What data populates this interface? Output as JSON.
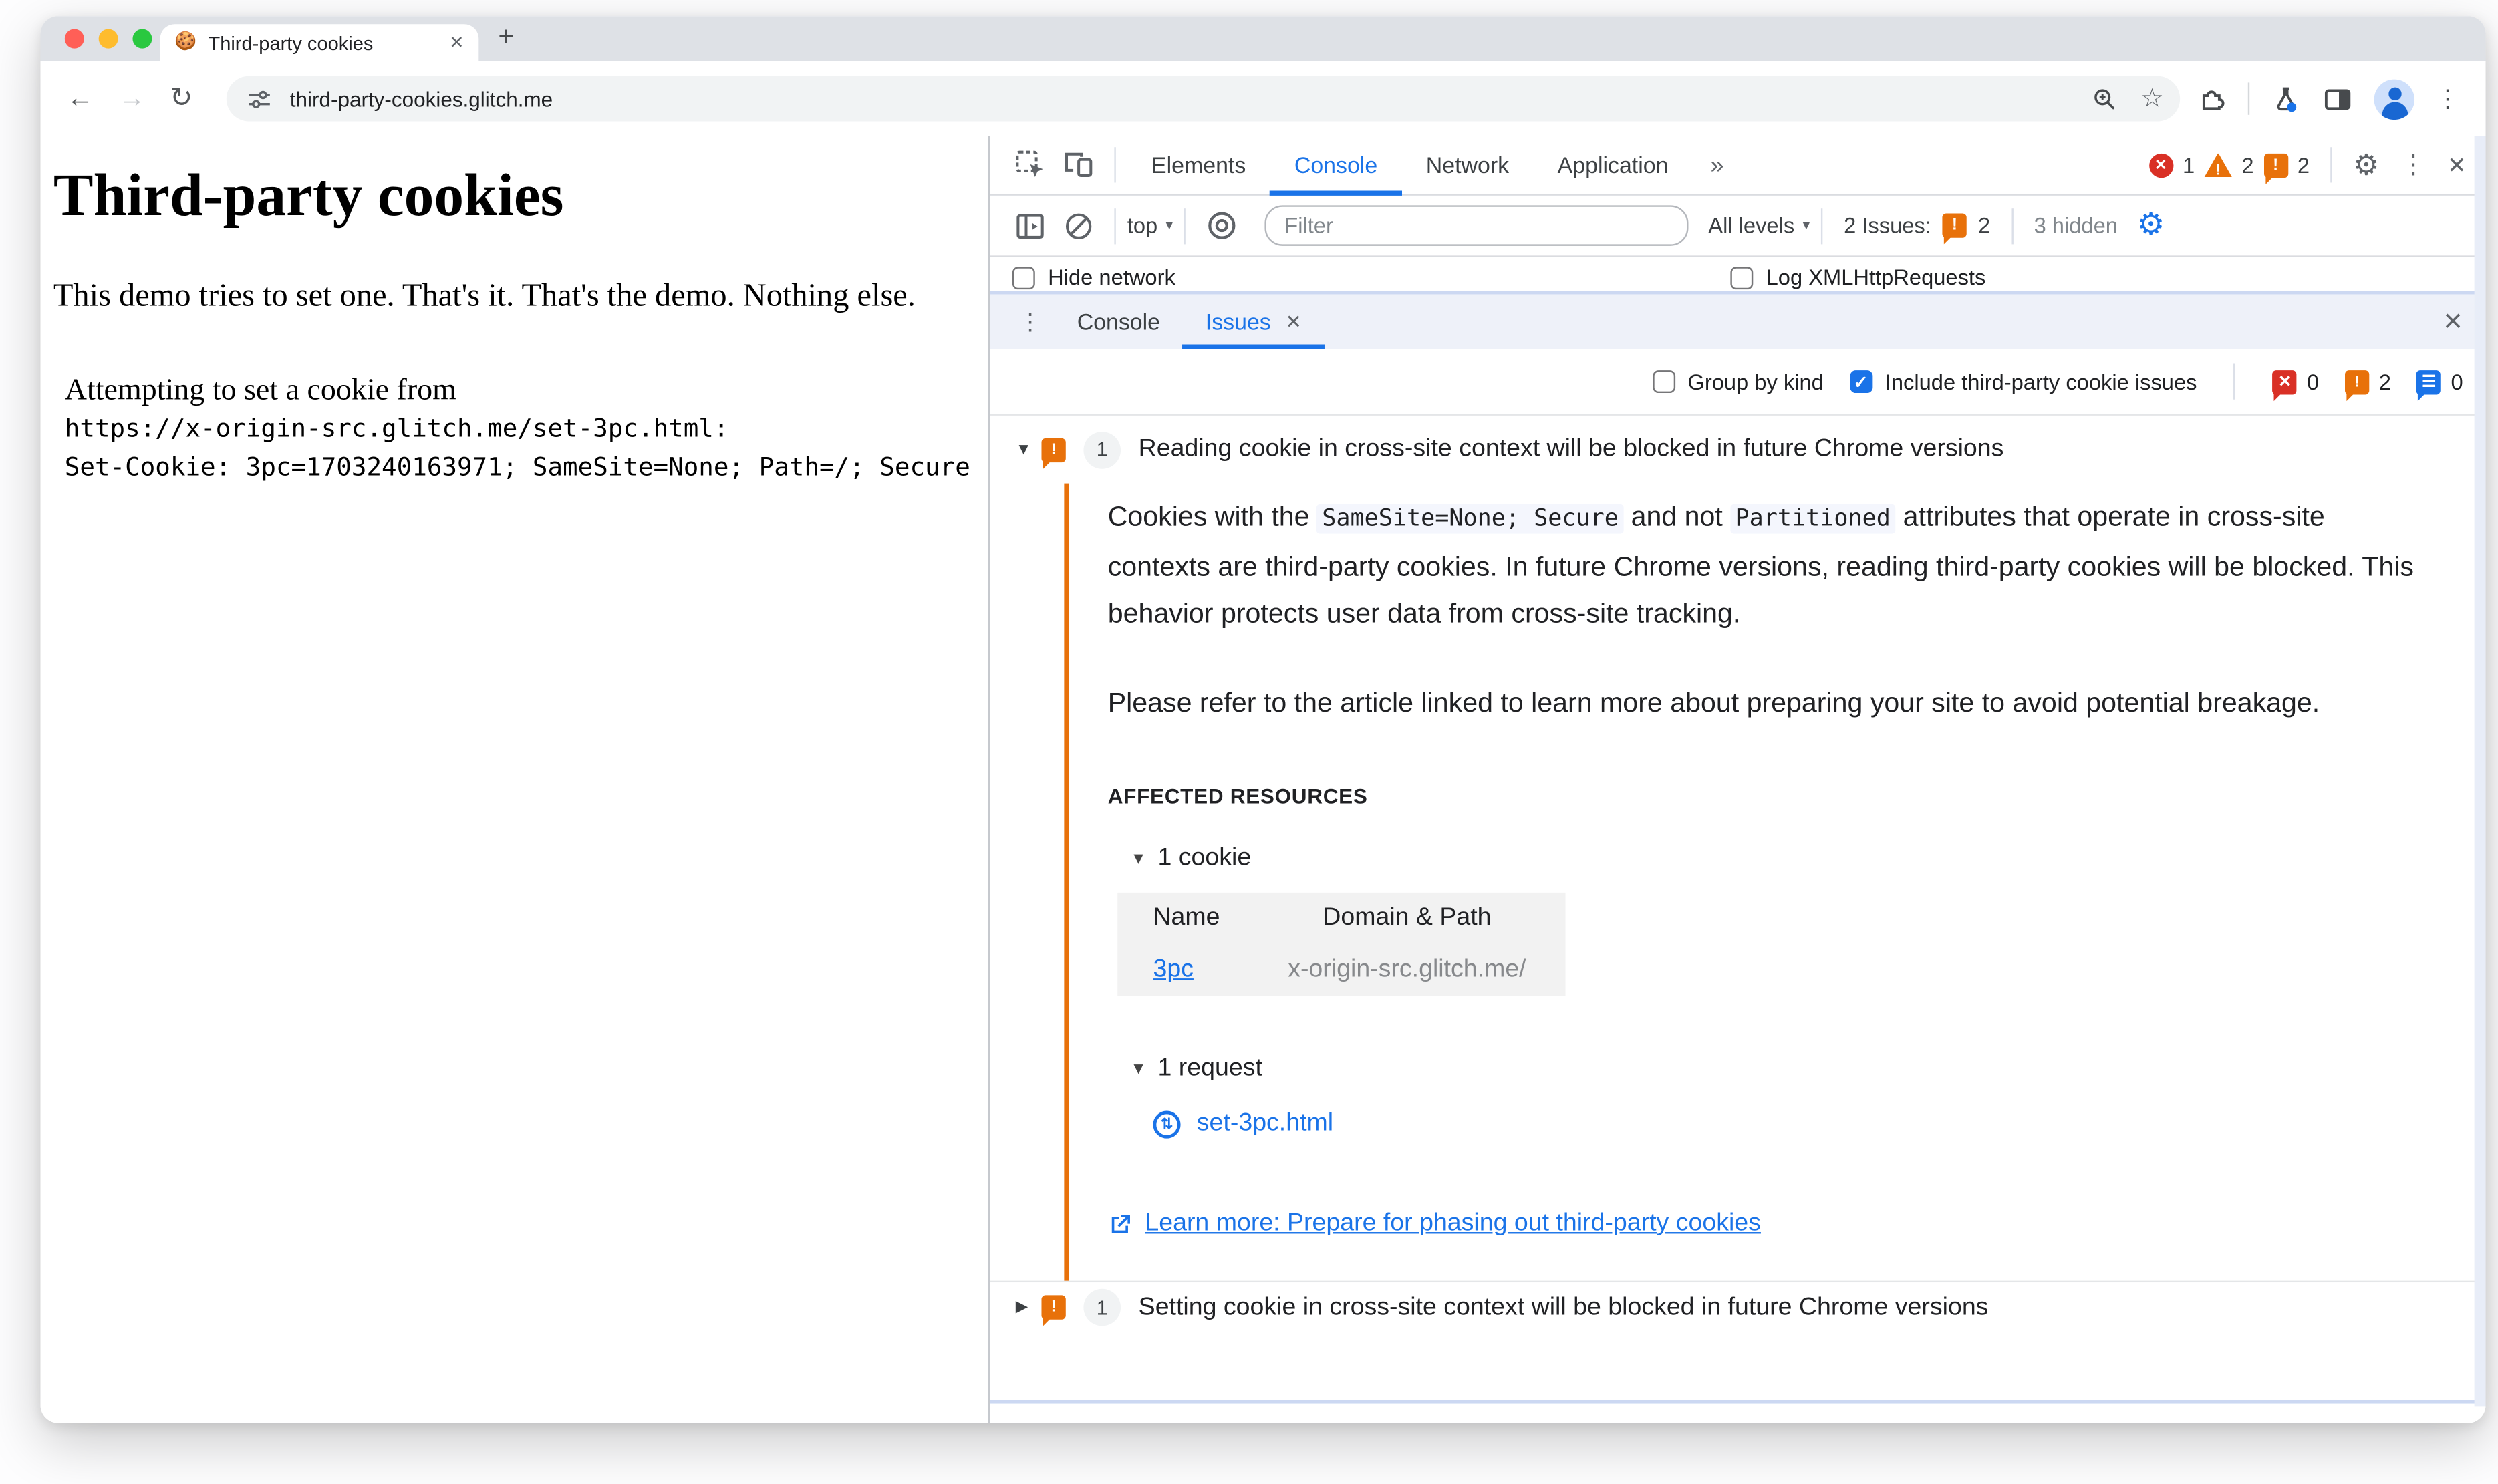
{
  "icons": {
    "cookie": "🍪",
    "close": "✕",
    "plus": "+",
    "back": "←",
    "forward": "→",
    "reload": "↻",
    "star": "☆",
    "dots_v": "⋮",
    "more_tabs": "»",
    "gear": "⚙",
    "caret": "▾",
    "tri_open": "▼",
    "tri_closed": "▶",
    "swap": "⇅",
    "lines": "☰",
    "exclaim": "!",
    "check": "✓"
  },
  "browser": {
    "tab_title": "Third-party cookies",
    "url": "third-party-cookies.glitch.me"
  },
  "page": {
    "heading": "Third-party cookies",
    "intro": "This demo tries to set one. That's it. That's the demo. Nothing else.",
    "log_line1": "Attempting to set a cookie from",
    "log_line2": "https://x-origin-src.glitch.me/set-3pc.html:",
    "log_line3": "Set-Cookie: 3pc=1703240163971; SameSite=None; Path=/; Secure"
  },
  "devtools": {
    "tabs": {
      "elements": "Elements",
      "console": "Console",
      "network": "Network",
      "application": "Application"
    },
    "badges": {
      "errors": "1",
      "warnings": "2",
      "issues": "2"
    },
    "console_toolbar": {
      "context": "top",
      "filter_placeholder": "Filter",
      "levels": "All levels",
      "issues_label": "2 Issues:",
      "issues_count": "2",
      "hidden": "3 hidden"
    },
    "settings_row": {
      "hide_network": "Hide network",
      "log_xhr": "Log XMLHttpRequests"
    },
    "drawer": {
      "console": "Console",
      "issues": "Issues"
    },
    "issues_toolbar": {
      "group": "Group by kind",
      "include": "Include third-party cookie issues",
      "errors": "0",
      "warnings": "2",
      "notes": "0"
    },
    "issue1": {
      "count": "1",
      "title": "Reading cookie in cross-site context will be blocked in future Chrome versions",
      "desc_a": "Cookies with the ",
      "code1": "SameSite=None; Secure",
      "desc_b": " and not ",
      "code2": "Partitioned",
      "desc_c": " attributes that operate in cross-site contexts are third-party cookies. In future Chrome versions, reading third-party cookies will be blocked. This behavior protects user data from cross-site tracking.",
      "desc2": "Please refer to the article linked to learn more about preparing your site to avoid potential breakage.",
      "affected": "AFFECTED RESOURCES",
      "cookie_group": "1 cookie",
      "col_name": "Name",
      "col_domain": "Domain & Path",
      "cookie_name": "3pc",
      "cookie_domain": "x-origin-src.glitch.me/",
      "request_group": "1 request",
      "request_file": "set-3pc.html",
      "learn_more": "Learn more: Prepare for phasing out third-party cookies"
    },
    "issue2": {
      "count": "1",
      "title": "Setting cookie in cross-site context will be blocked in future Chrome versions"
    }
  },
  "colors": {
    "accent": "#1a73e8",
    "issue_orange": "#e8710a",
    "error_red": "#d93025"
  }
}
